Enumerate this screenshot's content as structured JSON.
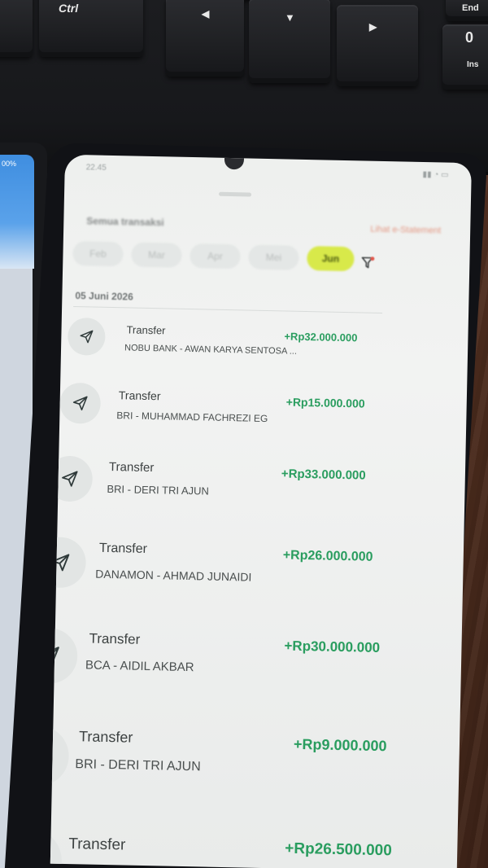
{
  "keyboard": {
    "keys": [
      {
        "id": "ctrl",
        "label": "Ctrl"
      },
      {
        "id": "arrow-left",
        "label": "◀"
      },
      {
        "id": "arrow-down",
        "label": "▼"
      },
      {
        "id": "arrow-right",
        "label": "▶"
      },
      {
        "id": "end",
        "label": "End"
      },
      {
        "id": "ins",
        "label": "0",
        "sub": "Ins"
      }
    ]
  },
  "left_device": {
    "text": "00%"
  },
  "status_bar": {
    "time": "22.45",
    "right": ""
  },
  "header": {
    "title": "Semua transaksi",
    "link": "Lihat e-Statement"
  },
  "months": [
    "Feb",
    "Mar",
    "Apr",
    "Mei",
    "Jun"
  ],
  "active_month": "Jun",
  "date_group": "05 Juni 2026",
  "transactions": [
    {
      "type": "Transfer",
      "desc": "NOBU BANK - AWAN KARYA SENTOSA ...",
      "amount": "+Rp32.000.000"
    },
    {
      "type": "Transfer",
      "desc": "BRI - MUHAMMAD FACHREZI EG",
      "amount": "+Rp15.000.000"
    },
    {
      "type": "Transfer",
      "desc": "BRI - DERI TRI AJUN",
      "amount": "+Rp33.000.000"
    },
    {
      "type": "Transfer",
      "desc": "DANAMON - AHMAD JUNAIDI",
      "amount": "+Rp26.000.000"
    },
    {
      "type": "Transfer",
      "desc": "BCA - AIDIL AKBAR",
      "amount": "+Rp30.000.000"
    },
    {
      "type": "Transfer",
      "desc": "BRI - DERI TRI AJUN",
      "amount": "+Rp9.000.000"
    },
    {
      "type": "Transfer",
      "desc": "",
      "amount": "+Rp26.500.000"
    }
  ],
  "colors": {
    "amount_green": "#2a9d5f",
    "active_chip": "#d8e94a",
    "link": "#e07a5f"
  }
}
